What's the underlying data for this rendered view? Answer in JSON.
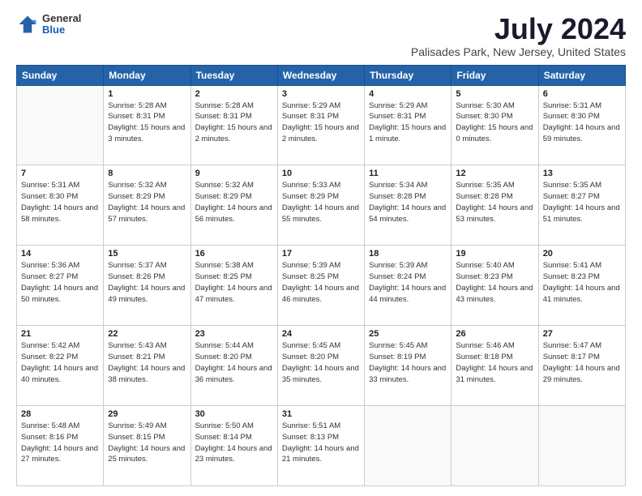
{
  "header": {
    "logo": {
      "general": "General",
      "blue": "Blue"
    },
    "title": "July 2024",
    "location": "Palisades Park, New Jersey, United States"
  },
  "days": [
    "Sunday",
    "Monday",
    "Tuesday",
    "Wednesday",
    "Thursday",
    "Friday",
    "Saturday"
  ],
  "weeks": [
    [
      {
        "date": "",
        "empty": true
      },
      {
        "date": "1",
        "sunrise": "5:28 AM",
        "sunset": "8:31 PM",
        "daylight": "15 hours and 3 minutes."
      },
      {
        "date": "2",
        "sunrise": "5:28 AM",
        "sunset": "8:31 PM",
        "daylight": "15 hours and 2 minutes."
      },
      {
        "date": "3",
        "sunrise": "5:29 AM",
        "sunset": "8:31 PM",
        "daylight": "15 hours and 2 minutes."
      },
      {
        "date": "4",
        "sunrise": "5:29 AM",
        "sunset": "8:31 PM",
        "daylight": "15 hours and 1 minute."
      },
      {
        "date": "5",
        "sunrise": "5:30 AM",
        "sunset": "8:30 PM",
        "daylight": "15 hours and 0 minutes."
      },
      {
        "date": "6",
        "sunrise": "5:31 AM",
        "sunset": "8:30 PM",
        "daylight": "14 hours and 59 minutes."
      }
    ],
    [
      {
        "date": "7",
        "sunrise": "5:31 AM",
        "sunset": "8:30 PM",
        "daylight": "14 hours and 58 minutes."
      },
      {
        "date": "8",
        "sunrise": "5:32 AM",
        "sunset": "8:29 PM",
        "daylight": "14 hours and 57 minutes."
      },
      {
        "date": "9",
        "sunrise": "5:32 AM",
        "sunset": "8:29 PM",
        "daylight": "14 hours and 56 minutes."
      },
      {
        "date": "10",
        "sunrise": "5:33 AM",
        "sunset": "8:29 PM",
        "daylight": "14 hours and 55 minutes."
      },
      {
        "date": "11",
        "sunrise": "5:34 AM",
        "sunset": "8:28 PM",
        "daylight": "14 hours and 54 minutes."
      },
      {
        "date": "12",
        "sunrise": "5:35 AM",
        "sunset": "8:28 PM",
        "daylight": "14 hours and 53 minutes."
      },
      {
        "date": "13",
        "sunrise": "5:35 AM",
        "sunset": "8:27 PM",
        "daylight": "14 hours and 51 minutes."
      }
    ],
    [
      {
        "date": "14",
        "sunrise": "5:36 AM",
        "sunset": "8:27 PM",
        "daylight": "14 hours and 50 minutes."
      },
      {
        "date": "15",
        "sunrise": "5:37 AM",
        "sunset": "8:26 PM",
        "daylight": "14 hours and 49 minutes."
      },
      {
        "date": "16",
        "sunrise": "5:38 AM",
        "sunset": "8:25 PM",
        "daylight": "14 hours and 47 minutes."
      },
      {
        "date": "17",
        "sunrise": "5:39 AM",
        "sunset": "8:25 PM",
        "daylight": "14 hours and 46 minutes."
      },
      {
        "date": "18",
        "sunrise": "5:39 AM",
        "sunset": "8:24 PM",
        "daylight": "14 hours and 44 minutes."
      },
      {
        "date": "19",
        "sunrise": "5:40 AM",
        "sunset": "8:23 PM",
        "daylight": "14 hours and 43 minutes."
      },
      {
        "date": "20",
        "sunrise": "5:41 AM",
        "sunset": "8:23 PM",
        "daylight": "14 hours and 41 minutes."
      }
    ],
    [
      {
        "date": "21",
        "sunrise": "5:42 AM",
        "sunset": "8:22 PM",
        "daylight": "14 hours and 40 minutes."
      },
      {
        "date": "22",
        "sunrise": "5:43 AM",
        "sunset": "8:21 PM",
        "daylight": "14 hours and 38 minutes."
      },
      {
        "date": "23",
        "sunrise": "5:44 AM",
        "sunset": "8:20 PM",
        "daylight": "14 hours and 36 minutes."
      },
      {
        "date": "24",
        "sunrise": "5:45 AM",
        "sunset": "8:20 PM",
        "daylight": "14 hours and 35 minutes."
      },
      {
        "date": "25",
        "sunrise": "5:45 AM",
        "sunset": "8:19 PM",
        "daylight": "14 hours and 33 minutes."
      },
      {
        "date": "26",
        "sunrise": "5:46 AM",
        "sunset": "8:18 PM",
        "daylight": "14 hours and 31 minutes."
      },
      {
        "date": "27",
        "sunrise": "5:47 AM",
        "sunset": "8:17 PM",
        "daylight": "14 hours and 29 minutes."
      }
    ],
    [
      {
        "date": "28",
        "sunrise": "5:48 AM",
        "sunset": "8:16 PM",
        "daylight": "14 hours and 27 minutes."
      },
      {
        "date": "29",
        "sunrise": "5:49 AM",
        "sunset": "8:15 PM",
        "daylight": "14 hours and 25 minutes."
      },
      {
        "date": "30",
        "sunrise": "5:50 AM",
        "sunset": "8:14 PM",
        "daylight": "14 hours and 23 minutes."
      },
      {
        "date": "31",
        "sunrise": "5:51 AM",
        "sunset": "8:13 PM",
        "daylight": "14 hours and 21 minutes."
      },
      {
        "date": "",
        "empty": true
      },
      {
        "date": "",
        "empty": true
      },
      {
        "date": "",
        "empty": true
      }
    ]
  ],
  "labels": {
    "sunrise": "Sunrise:",
    "sunset": "Sunset:",
    "daylight": "Daylight:"
  }
}
